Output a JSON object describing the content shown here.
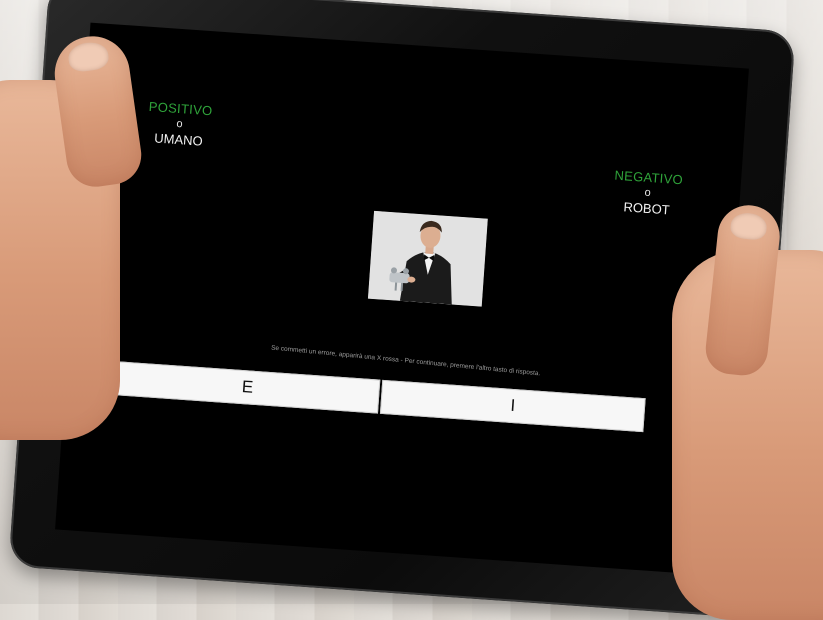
{
  "iat": {
    "left_category": {
      "attribute": "POSITIVO",
      "separator": "o",
      "target": "UMANO"
    },
    "right_category": {
      "attribute": "NEGATIVO",
      "separator": "o",
      "target": "ROBOT"
    },
    "instruction": "Se commetti un errore, apparirà una X rossa - Per continuare, premere l'altro tasto di risposta.",
    "buttons": {
      "left_key": "E",
      "right_key": "I"
    }
  },
  "colors": {
    "screen_background": "#000000",
    "attribute_label": "#2fa33a",
    "target_label": "#f2f2f2",
    "button_background": "#f7f7f7"
  }
}
